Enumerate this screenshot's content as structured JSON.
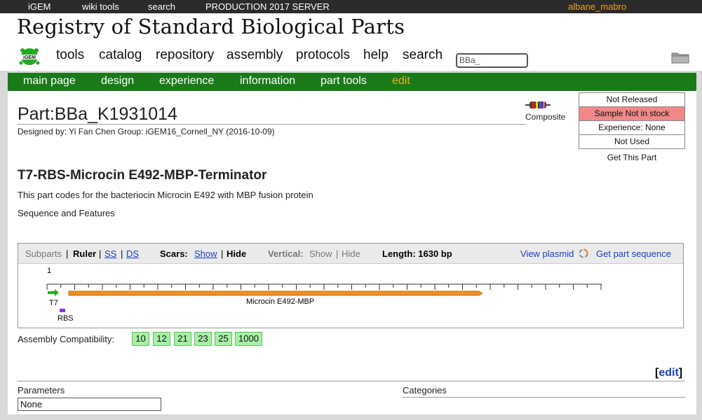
{
  "topbar": {
    "igem": "iGEM",
    "wiki_tools": "wiki tools",
    "search": "search",
    "server": "PRODUCTION 2017 SERVER",
    "user": "albane_mabro"
  },
  "header": {
    "title": "Registry of Standard Biological Parts",
    "nav": [
      "tools",
      "catalog",
      "repository",
      "assembly",
      "protocols",
      "help",
      "search"
    ],
    "search_value": "BBa_"
  },
  "subnav": {
    "items": [
      "main page",
      "design",
      "experience",
      "information",
      "part tools"
    ],
    "edit": "edit"
  },
  "part": {
    "title": "Part:BBa_K1931014",
    "designed_by": "Designed by: Yi Fan Chen   Group: iGEM16_Cornell_NY   (2016-10-09)",
    "type": "Composite",
    "name": "T7-RBS-Microcin E492-MBP-Terminator",
    "description": "This part codes for the bacteriocin Microcin E492 with MBP fusion protein",
    "sequence_heading": "Sequence and Features"
  },
  "status": {
    "rows": [
      "Not Released",
      "Sample Not in stock",
      "Experience: None",
      "Not Used"
    ],
    "get_part": "Get This Part"
  },
  "sequence_viewer": {
    "subparts": "Subparts",
    "sep1": "|",
    "ruler": "Ruler",
    "sep2": "|",
    "ss": "SS",
    "sep3": "|",
    "ds": "DS",
    "scars_label": "Scars:",
    "show": "Show",
    "sep4": "|",
    "hide": "Hide",
    "vertical_label": "Vertical:",
    "vshow": "Show",
    "sep5": "|",
    "vhide": "Hide",
    "length": "Length: 1630 bp",
    "view_plasmid": "View plasmid",
    "get_sequence": "Get part sequence",
    "ruler_start": "1",
    "features": {
      "t7": "T7",
      "rbs": "RBS",
      "cds": "Microcin E492-MBP"
    },
    "colors": {
      "promoter": "#22aa22",
      "rbs": "#8833ee",
      "cds": "#f0901e"
    }
  },
  "assembly": {
    "label": "Assembly Compatibility:",
    "standards": [
      "10",
      "12",
      "21",
      "23",
      "25",
      "1000"
    ]
  },
  "footer": {
    "edit_open": "[",
    "edit": "edit",
    "edit_close": "]",
    "parameters": "Parameters",
    "parameters_value": "None",
    "categories": "Categories"
  }
}
